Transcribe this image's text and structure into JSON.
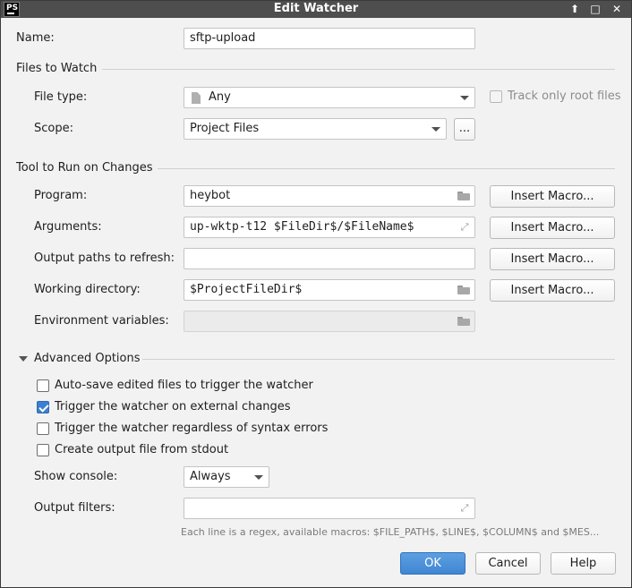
{
  "window": {
    "title": "Edit Watcher",
    "app_icon_text": "PS",
    "controls": {
      "up": "⬆",
      "maximize": "□",
      "close": "✕"
    }
  },
  "name": {
    "label": "Name:",
    "value": "sftp-upload"
  },
  "files_to_watch": {
    "title": "Files to Watch",
    "file_type": {
      "label": "File type:",
      "value": "Any",
      "icon": "file-icon"
    },
    "track_only_root": {
      "label": "Track only root files",
      "checked": false,
      "enabled": false
    },
    "scope": {
      "label": "Scope:",
      "value": "Project Files",
      "browse_label": "..."
    }
  },
  "tool": {
    "title": "Tool to Run on Changes",
    "program": {
      "label": "Program:",
      "value": "heybot",
      "button": "Insert Macro..."
    },
    "arguments": {
      "label": "Arguments:",
      "value": "up-wktp-t12 $FileDir$/$FileName$",
      "button": "Insert Macro..."
    },
    "output_paths": {
      "label": "Output paths to refresh:",
      "value": "",
      "button": "Insert Macro..."
    },
    "working_dir": {
      "label": "Working directory:",
      "value": "$ProjectFileDir$",
      "button": "Insert Macro..."
    },
    "env_vars": {
      "label": "Environment variables:",
      "value": ""
    }
  },
  "advanced": {
    "title": "Advanced Options",
    "options": [
      {
        "label": "Auto-save edited files to trigger the watcher",
        "checked": false
      },
      {
        "label": "Trigger the watcher on external changes",
        "checked": true
      },
      {
        "label": "Trigger the watcher regardless of syntax errors",
        "checked": false
      },
      {
        "label": "Create output file from stdout",
        "checked": false
      }
    ],
    "show_console": {
      "label": "Show console:",
      "value": "Always"
    },
    "output_filters": {
      "label": "Output filters:",
      "value": "",
      "hint": "Each line is a regex, available macros: $FILE_PATH$, $LINE$, $COLUMN$ and $MES..."
    }
  },
  "buttons": {
    "ok": "OK",
    "cancel": "Cancel",
    "help": "Help"
  },
  "colors": {
    "titlebar": "#4e4e4e",
    "primary_button": "#4a8fdb",
    "checkbox_checked": "#3d7fd0"
  }
}
